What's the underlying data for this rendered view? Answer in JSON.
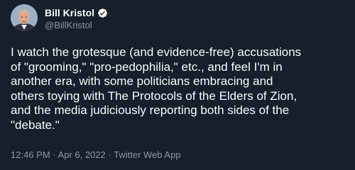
{
  "author": {
    "display_name": "Bill Kristol",
    "handle": "@BillKristol",
    "verified": true
  },
  "tweet": {
    "text": "I watch the grotesque (and evidence-free) accusations\nof \"grooming,\" \"pro-pedophilia,\" etc., and feel I'm in\nanother era, with some politicians embracing and\nothers toying with The Protocols of the Elders of Zion,\nand the media judiciously reporting both sides of the\n\"debate.\""
  },
  "meta": {
    "time": "12:46 PM",
    "separator": "·",
    "date": "Apr 6, 2022",
    "source": "Twitter Web App"
  },
  "colors": {
    "background": "#15202b",
    "primary_text": "#f7f9f9",
    "secondary_text": "#8b98a5",
    "verified_badge": "#ffffff"
  },
  "icons": {
    "verified": "verified-badge-icon"
  }
}
